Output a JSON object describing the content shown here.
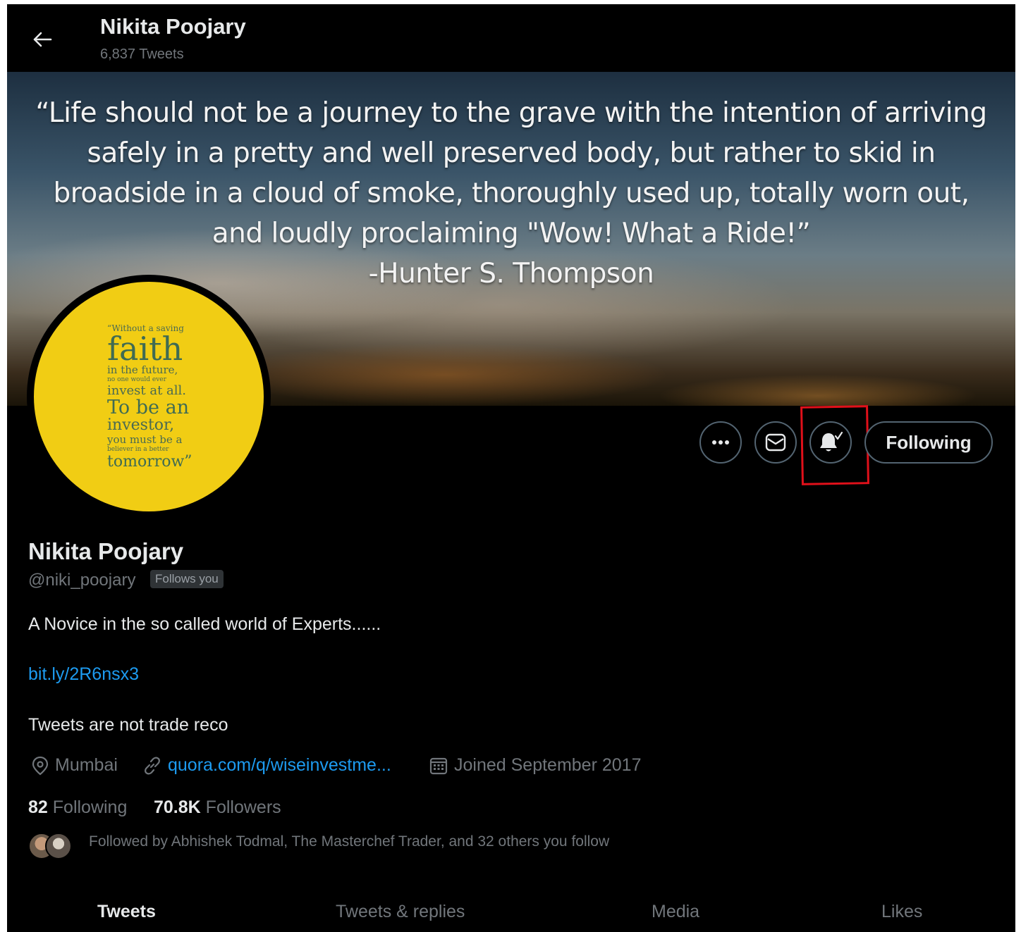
{
  "header": {
    "name": "Nikita Poojary",
    "tweet_count": "6,837 Tweets"
  },
  "banner": {
    "quote_lines": [
      "“Life should not be a journey to the grave with the intention of arriving",
      "safely in a pretty and well preserved body, but rather to skid in",
      "broadside in a cloud of smoke, thoroughly used up, totally worn out,",
      "and loudly proclaiming \"Wow! What a Ride!”",
      "-Hunter S. Thompson"
    ]
  },
  "avatar": {
    "lines": [
      "“Without a saving",
      "faith",
      "in the future,",
      "no one would ever",
      "invest at all.",
      "To be an",
      "investor,",
      "you must be a",
      "believer in a better",
      "tomorrow”"
    ]
  },
  "actions": {
    "more_icon": "more-icon",
    "message_icon": "envelope-icon",
    "notify_icon": "bell-check-icon",
    "follow_label": "Following"
  },
  "profile": {
    "name": "Nikita Poojary",
    "handle": "@niki_poojary",
    "follows_you": "Follows you",
    "bio": "A Novice in the so called world of Experts......",
    "bio_link": "bit.ly/2R6nsx3",
    "bio_note": "Tweets are not trade reco",
    "location": "Mumbai",
    "website": "quora.com/q/wiseinvestme...",
    "joined": "Joined September 2017",
    "following_count": "82",
    "following_label": "Following",
    "followers_count": "70.8K",
    "followers_label": "Followers",
    "followed_by": "Followed by Abhishek Todmal, The Masterchef Trader, and 32 others you follow"
  },
  "tabs": [
    {
      "label": "Tweets",
      "active": true
    },
    {
      "label": "Tweets & replies",
      "active": false
    },
    {
      "label": "Media",
      "active": false
    },
    {
      "label": "Likes",
      "active": false
    }
  ],
  "colors": {
    "background": "#000000",
    "text_primary": "#e7e9ea",
    "text_secondary": "#71767b",
    "link": "#1d9bf0",
    "avatar_bg": "#f1cd14",
    "highlight": "#e0101a"
  }
}
